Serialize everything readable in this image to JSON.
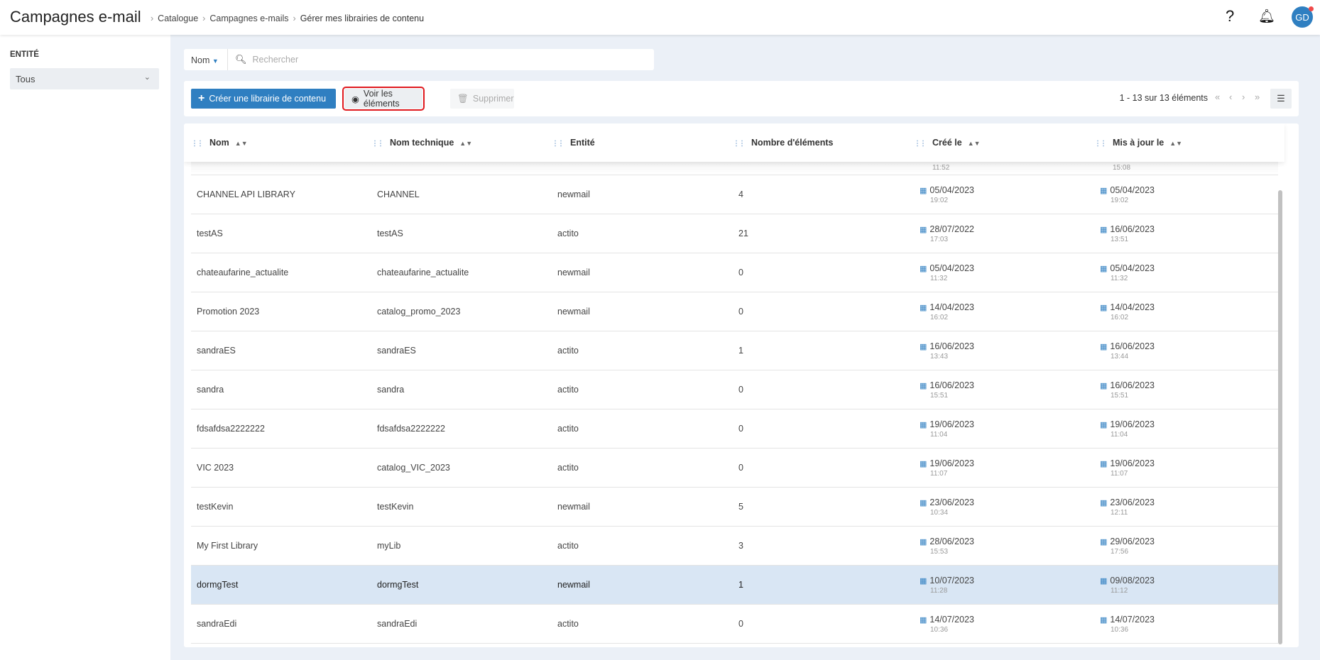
{
  "header": {
    "title": "Campagnes e-mail",
    "breadcrumb": [
      "Catalogue",
      "Campagnes e-mails",
      "Gérer mes librairies de contenu"
    ],
    "help": "?",
    "avatar": "GD"
  },
  "sidebar": {
    "label": "ENTITÉ",
    "select_value": "Tous"
  },
  "search": {
    "field": "Nom",
    "placeholder": "Rechercher"
  },
  "toolbar": {
    "create": "Créer une librairie de contenu",
    "view": "Voir les éléments",
    "delete": "Supprimer",
    "pager": "1 - 13 sur 13 éléments"
  },
  "columns": [
    "Nom",
    "Nom technique",
    "Entité",
    "Nombre d'éléments",
    "Créé le",
    "Mis à jour le"
  ],
  "partial_row": {
    "created_time": "11:52",
    "updated_time": "15:08"
  },
  "rows": [
    {
      "name": "CHANNEL API LIBRARY",
      "tech": "CHANNEL",
      "entity": "newmail",
      "count": "4",
      "created": "05/04/2023",
      "created_time": "19:02",
      "updated": "05/04/2023",
      "updated_time": "19:02"
    },
    {
      "name": "testAS",
      "tech": "testAS",
      "entity": "actito",
      "count": "21",
      "created": "28/07/2022",
      "created_time": "17:03",
      "updated": "16/06/2023",
      "updated_time": "13:51"
    },
    {
      "name": "chateaufarine_actualite",
      "tech": "chateaufarine_actualite",
      "entity": "newmail",
      "count": "0",
      "created": "05/04/2023",
      "created_time": "11:32",
      "updated": "05/04/2023",
      "updated_time": "11:32"
    },
    {
      "name": "Promotion 2023",
      "tech": "catalog_promo_2023",
      "entity": "newmail",
      "count": "0",
      "created": "14/04/2023",
      "created_time": "16:02",
      "updated": "14/04/2023",
      "updated_time": "16:02"
    },
    {
      "name": "sandraES",
      "tech": "sandraES",
      "entity": "actito",
      "count": "1",
      "created": "16/06/2023",
      "created_time": "13:43",
      "updated": "16/06/2023",
      "updated_time": "13:44"
    },
    {
      "name": "sandra",
      "tech": "sandra",
      "entity": "actito",
      "count": "0",
      "created": "16/06/2023",
      "created_time": "15:51",
      "updated": "16/06/2023",
      "updated_time": "15:51"
    },
    {
      "name": "fdsafdsa2222222",
      "tech": "fdsafdsa2222222",
      "entity": "actito",
      "count": "0",
      "created": "19/06/2023",
      "created_time": "11:04",
      "updated": "19/06/2023",
      "updated_time": "11:04"
    },
    {
      "name": "VIC 2023",
      "tech": "catalog_VIC_2023",
      "entity": "actito",
      "count": "0",
      "created": "19/06/2023",
      "created_time": "11:07",
      "updated": "19/06/2023",
      "updated_time": "11:07"
    },
    {
      "name": "testKevin",
      "tech": "testKevin",
      "entity": "newmail",
      "count": "5",
      "created": "23/06/2023",
      "created_time": "10:34",
      "updated": "23/06/2023",
      "updated_time": "12:11"
    },
    {
      "name": "My First Library",
      "tech": "myLib",
      "entity": "actito",
      "count": "3",
      "created": "28/06/2023",
      "created_time": "15:53",
      "updated": "29/06/2023",
      "updated_time": "17:56"
    },
    {
      "name": "dormgTest",
      "tech": "dormgTest",
      "entity": "newmail",
      "count": "1",
      "created": "10/07/2023",
      "created_time": "11:28",
      "updated": "09/08/2023",
      "updated_time": "11:12",
      "selected": true
    },
    {
      "name": "sandraEdi",
      "tech": "sandraEdi",
      "entity": "actito",
      "count": "0",
      "created": "14/07/2023",
      "created_time": "10:36",
      "updated": "14/07/2023",
      "updated_time": "10:36"
    }
  ],
  "colors": {
    "accent": "#2f7fc1",
    "selected_row": "#d9e6f4",
    "highlight_border": "#e0191e",
    "background": "#ebf0f7"
  }
}
